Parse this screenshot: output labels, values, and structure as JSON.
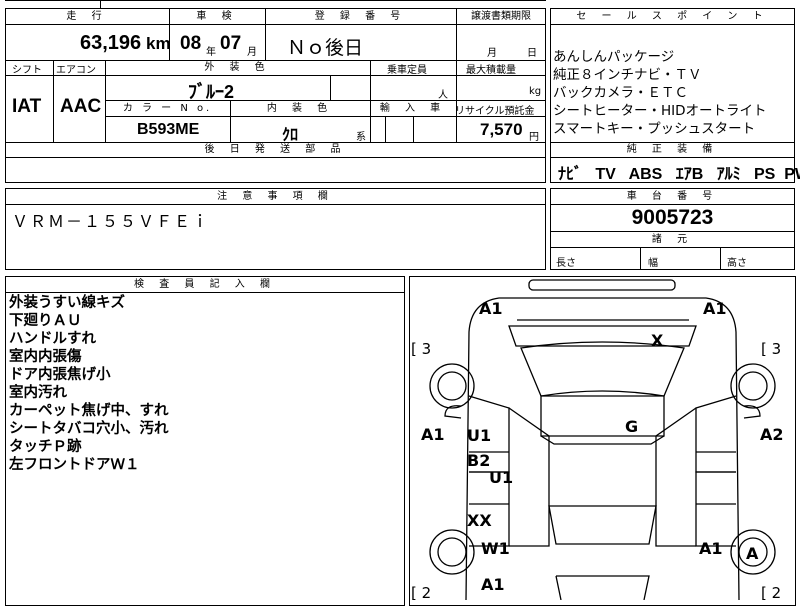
{
  "top_sheet": {
    "labels": {
      "mileage": "走 行",
      "inspection": "車 検",
      "registration": "登 録 番 号",
      "transfer": "譲渡書類期限",
      "shift": "シフト",
      "aircon": "エアコン",
      "exterior": "外 装 色",
      "capacity": "乗車定員",
      "max_load": "最大積載量",
      "color_no": "カ ラ ー N o.",
      "interior": "内 装 色",
      "import": "輸 入 車",
      "recycle": "リサイクル預託金",
      "later_parts": "後 日 発 送 部 品",
      "km_unit": "km",
      "year_unit": "年",
      "month_unit": "月",
      "day_unit": "日",
      "person_unit": "人",
      "kg_unit": "kg",
      "yen_unit": "円",
      "interior_suffix": "系"
    },
    "values": {
      "mileage": "63,196",
      "inspection_year": "08",
      "inspection_month": "07",
      "registration": "Ｎｏ後日",
      "shift": "IAT",
      "aircon": "AAC",
      "exterior_color": "ﾌﾞﾙｰ2",
      "color_no": "B593ME",
      "interior_color": "ｸﾛ",
      "recycle": "7,570"
    }
  },
  "sales_points": {
    "header": "セ ー ル ス ポ イ ン ト",
    "items": [
      "あんしんパッケージ",
      "純正８インチナビ・ＴＶ",
      "バックカメラ・ＥＴＣ",
      "シートヒーター・HIDオートライト",
      "スマートキー・プッシュスタート"
    ]
  },
  "equipment": {
    "header": "純 正 装 備",
    "items": [
      "ﾅﾋﾞ",
      "TV",
      "ABS",
      "ｴｱB",
      "ｱﾙﾐ",
      "PS",
      "PW"
    ]
  },
  "notes": {
    "header": "注 意 事 項 欄",
    "text": "ＶＲＭ－１５５ＶＦＥｉ"
  },
  "chassis": {
    "header": "車 台 番 号",
    "number": "9005723",
    "dims_header": "諸 元",
    "length_label": "長さ",
    "width_label": "幅",
    "height_label": "高さ"
  },
  "inspector": {
    "header": "検 査 員 記 入 欄",
    "lines": [
      "外装うすい線キズ",
      "下廻りＡＵ",
      "ハンドルすれ",
      "室内内張傷",
      "ドア内張焦げ小",
      "室内汚れ",
      "カーペット焦げ中、すれ",
      "シートタバコ穴小、汚れ",
      "タッチＰ跡",
      "左フロントドアＷ１"
    ]
  },
  "diagram": {
    "marks": {
      "a1_tl": "A1",
      "a1_tr": "A1",
      "x_roof": "X",
      "a1_left": "A1",
      "a2_right": "A2",
      "g_center": "G",
      "u1_left": "U1",
      "b2_left": "B2",
      "u1_mid": "U1",
      "xx_left": "XX",
      "w1_left": "W1",
      "a1_lower_right": "A1",
      "a_wheel": "A",
      "a1_bottom": "A1"
    },
    "brackets": {
      "left_top": "[ 3",
      "right_top": "[ 3",
      "left_bottom": "[ 2",
      "right_bottom": "[ 2"
    }
  }
}
